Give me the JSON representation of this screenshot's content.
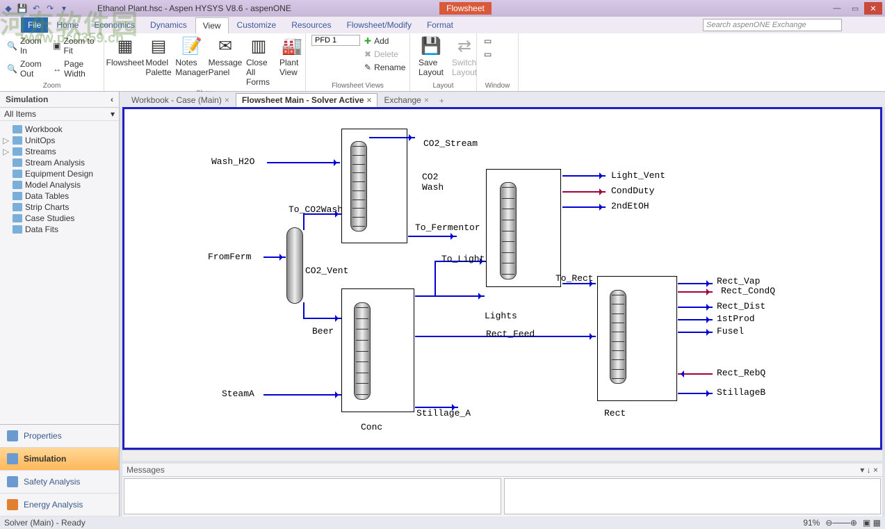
{
  "title": "Ethanol Plant.hsc - Aspen HYSYS V8.6 - aspenONE",
  "context_tab": "Flowsheet",
  "search_placeholder": "Search aspenONE Exchange",
  "menu": {
    "file": "File",
    "home": "Home",
    "economics": "Economics",
    "dynamics": "Dynamics",
    "view": "View",
    "customize": "Customize",
    "resources": "Resources",
    "flowsheet_modify": "Flowsheet/Modify",
    "format": "Format"
  },
  "ribbon": {
    "zoom_in": "Zoom In",
    "zoom_out": "Zoom Out",
    "zoom_to_fit": "Zoom to Fit",
    "page_width": "Page Width",
    "zoom_label": "Zoom",
    "flowsheet": "Flowsheet",
    "model_palette": "Model Palette",
    "notes_manager": "Notes Manager",
    "message_panel": "Message Panel",
    "close_all_forms": "Close All Forms",
    "plant_view": "Plant View",
    "show_label": "Show",
    "pfd_combo": "PFD 1",
    "add": "Add",
    "delete": "Delete",
    "rename": "Rename",
    "flowsheet_views": "Flowsheet Views",
    "save_layout": "Save Layout",
    "switch_layout": "Switch Layout",
    "layout_label": "Layout",
    "window_label": "Window"
  },
  "sidebar": {
    "header": "Simulation",
    "filter": "All Items",
    "items": [
      {
        "label": "Workbook",
        "exp": ""
      },
      {
        "label": "UnitOps",
        "exp": "▷"
      },
      {
        "label": "Streams",
        "exp": "▷"
      },
      {
        "label": "Stream Analysis",
        "exp": ""
      },
      {
        "label": "Equipment Design",
        "exp": ""
      },
      {
        "label": "Model Analysis",
        "exp": ""
      },
      {
        "label": "Data Tables",
        "exp": ""
      },
      {
        "label": "Strip Charts",
        "exp": ""
      },
      {
        "label": "Case Studies",
        "exp": ""
      },
      {
        "label": "Data Fits",
        "exp": ""
      }
    ],
    "sections": [
      {
        "label": "Properties",
        "active": false
      },
      {
        "label": "Simulation",
        "active": true
      },
      {
        "label": "Safety Analysis",
        "active": false
      },
      {
        "label": "Energy Analysis",
        "active": false
      }
    ]
  },
  "tabs": [
    {
      "label": "Workbook - Case (Main)",
      "active": false
    },
    {
      "label": "Flowsheet Main - Solver Active",
      "active": true
    },
    {
      "label": "Exchange",
      "active": false
    }
  ],
  "streams": {
    "wash_h2o": "Wash_H2O",
    "co2_stream": "CO2_Stream",
    "co2_wash": "CO2 Wash",
    "to_co2wash": "To_CO2Wash",
    "to_fermentor": "To_Fermentor",
    "fromferm": "FromFerm",
    "co2_vent": "CO2_Vent",
    "beer": "Beer",
    "to_light": "To_Light",
    "light_vent": "Light_Vent",
    "condduty": "CondDuty",
    "secondetoh": "2ndEtOH",
    "to_rect": "To_Rect",
    "lights": "Lights",
    "rect_feed": "Rect_Feed",
    "rect_vap": "Rect_Vap",
    "rect_condq": "Rect_CondQ",
    "rect_dist": "Rect_Dist",
    "firstprod": "1stProd",
    "fusel": "Fusel",
    "rect_rebq": "Rect_RebQ",
    "stillageb": "StillageB",
    "steama": "SteamA",
    "stillage_a": "Stillage_A",
    "conc": "Conc",
    "rect": "Rect"
  },
  "messages_header": "Messages",
  "status": {
    "left": "Solver (Main) - Ready",
    "zoom": "91%"
  }
}
